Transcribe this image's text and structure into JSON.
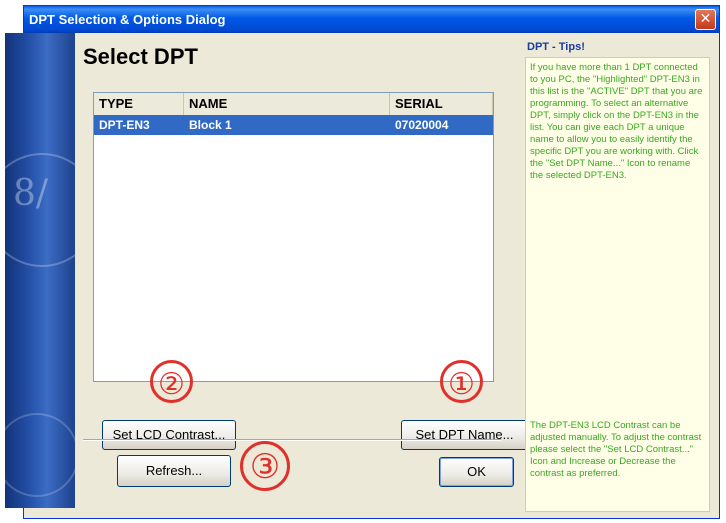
{
  "window": {
    "title": "DPT Selection & Options Dialog",
    "close_glyph": "✕"
  },
  "main": {
    "heading": "Select DPT"
  },
  "dpt_list": {
    "columns": [
      "TYPE",
      "NAME",
      "SERIAL"
    ],
    "rows": [
      {
        "type": "DPT-EN3",
        "name": "Block 1",
        "serial": "07020004",
        "selected": true
      }
    ]
  },
  "buttons": {
    "set_lcd_contrast": "Set LCD Contrast...",
    "set_dpt_name": "Set DPT Name...",
    "refresh": "Refresh...",
    "ok": "OK"
  },
  "callouts": {
    "one": "①",
    "two": "②",
    "three": "③"
  },
  "tips": {
    "title": "DPT - Tips!",
    "text_selection": "If you have more than 1 DPT connected to you PC, the \"Highlighted\" DPT-EN3 in this list is the \"ACTIVE\" DPT that you are programming. To select an alternative DPT, simply click on the DPT-EN3 in the list. You can give each DPT a unique name to allow you to easily identify the specific DPT you are working with. Click the \"Set DPT Name...\" Icon to rename the selected DPT-EN3.",
    "text_contrast": "The DPT-EN3 LCD Contrast can be adjusted manually. To adjust the contrast please select the \"Set LCD Contrast...\" Icon and Increase or Decrease the contrast as preferred."
  },
  "colors": {
    "titlebar": "#0058e6",
    "selection": "#316ac5",
    "tips_text": "#3aa623",
    "tips_title": "#1a3c9c",
    "callout": "#e0302a"
  }
}
